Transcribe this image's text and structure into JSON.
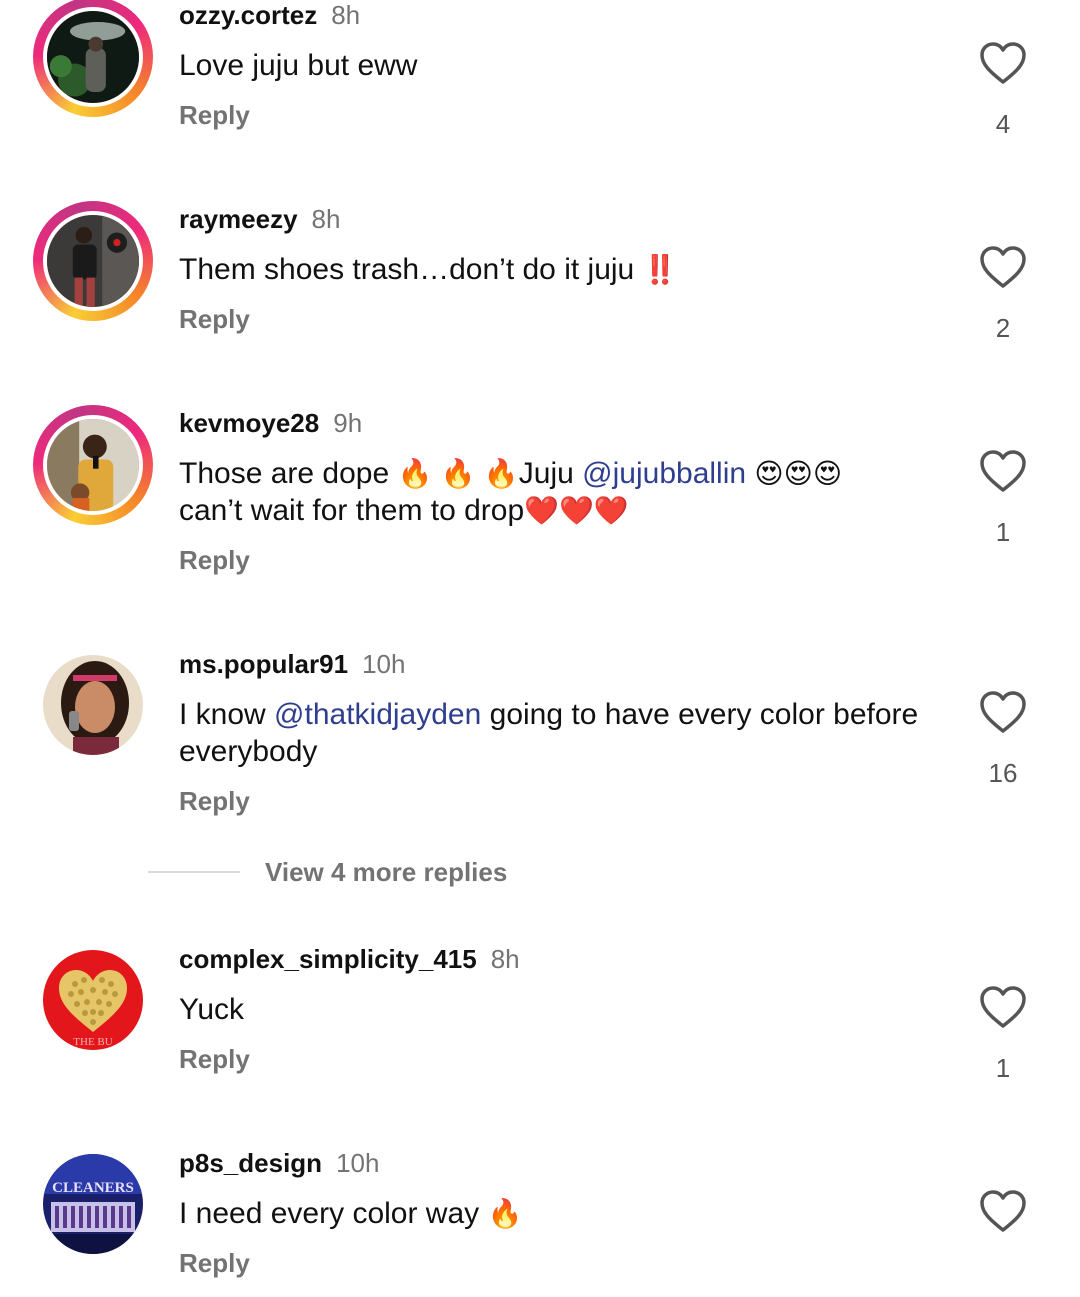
{
  "comments": [
    {
      "username": "ozzy.cortez",
      "time": "8h",
      "text": "Love juju but eww",
      "reply_label": "Reply",
      "likes": "4",
      "avatar_icon": "person-night-photo"
    },
    {
      "username": "raymeezy",
      "time": "8h",
      "text_part1": "Them shoes trash…don’t do it juju ",
      "text_emoji": "‼️",
      "reply_label": "Reply",
      "likes": "2",
      "avatar_icon": "person-standing-photo"
    },
    {
      "username": "kevmoye28",
      "time": "9h",
      "text_part1": "Those are dope ",
      "fire_emoji": "🔥",
      "text_part2": "Juju ",
      "mention": "@jujubballin",
      "heart_eyes_emoji": "😍",
      "text_part3": "can’t wait for them to drop",
      "red_heart_emoji": "❤️",
      "reply_label": "Reply",
      "likes": "1",
      "avatar_icon": "person-selfie-photo"
    },
    {
      "username": "ms.popular91",
      "time": "10h",
      "text_part1": "I know ",
      "mention": "@thatkidjayden",
      "text_part2": " going to have every color before everybody",
      "reply_label": "Reply",
      "likes": "16",
      "avatar_icon": "woman-phone-photo"
    },
    {
      "username": "complex_simplicity_415",
      "time": "8h",
      "text": "Yuck",
      "reply_label": "Reply",
      "likes": "1",
      "avatar_icon": "gold-heart-logo",
      "avatar_text": "THE BU"
    },
    {
      "username": "p8s_design",
      "time": "10h",
      "text_part1": "I need every color way ",
      "fire_emoji": "🔥",
      "reply_label": "Reply",
      "avatar_icon": "cleaners-store-photo",
      "avatar_text": "CLEANERS"
    }
  ],
  "view_more_replies": "View 4 more replies",
  "colors": {
    "mention": "#2f3e8f",
    "secondary_text": "#737373",
    "story_ring": "#ee2a7b"
  }
}
